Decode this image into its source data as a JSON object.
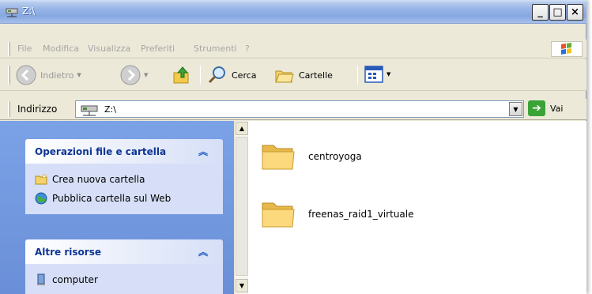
{
  "window": {
    "title": "Z:\\",
    "controls": {
      "minimize": "_",
      "maximize": "□",
      "close": "×"
    }
  },
  "menubar": {
    "items": [
      "File",
      "Modifica",
      "Visualizza",
      "Preferiti",
      "Strumenti",
      "?"
    ]
  },
  "toolbar": {
    "back_label": "Indietro",
    "search_label": "Cerca",
    "folders_label": "Cartelle"
  },
  "address": {
    "label": "Indirizzo",
    "value": "Z:\\",
    "go_label": "Vai"
  },
  "taskpane": {
    "file_tasks": {
      "title": "Operazioni file e cartella",
      "items": [
        "Crea nuova cartella",
        "Pubblica cartella sul Web"
      ]
    },
    "other_places": {
      "title": "Altre risorse",
      "items": [
        "computer"
      ]
    }
  },
  "files": [
    {
      "name": "centroyoga",
      "icon": "folder-icon"
    },
    {
      "name": "freenas_raid1_virtuale",
      "icon": "folder-icon"
    }
  ],
  "colors": {
    "title_gradient_top": "#d2e0f6",
    "title_gradient_bottom": "#86a7e2",
    "task_link": "#215dc6",
    "task_body": "#d6dff7",
    "go_green": "#3aa336"
  }
}
